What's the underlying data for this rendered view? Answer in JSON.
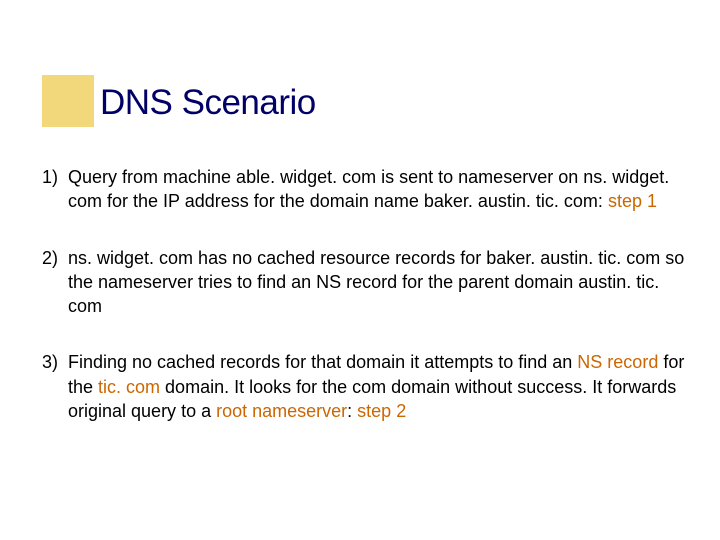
{
  "title": "DNS Scenario",
  "items": [
    {
      "number": "1)",
      "parts": [
        {
          "text": "Query from machine able. widget. com is sent to nameserver on ns. widget. com for the IP address for the domain name baker. austin. tic. com: ",
          "highlight": false
        },
        {
          "text": "step 1",
          "highlight": true
        }
      ]
    },
    {
      "number": "2)",
      "parts": [
        {
          "text": "ns. widget. com has no cached resource records for baker. austin. tic. com so the nameserver tries to find an NS record for the parent domain austin. tic. com",
          "highlight": false
        }
      ]
    },
    {
      "number": "3)",
      "parts": [
        {
          "text": "Finding no cached records for that domain it attempts to find an ",
          "highlight": false
        },
        {
          "text": "NS record",
          "highlight": true
        },
        {
          "text": " for the ",
          "highlight": false
        },
        {
          "text": "tic. com",
          "highlight": true
        },
        {
          "text": " domain. It looks for the com domain without success. It forwards original query to a ",
          "highlight": false
        },
        {
          "text": "root nameserver",
          "highlight": true
        },
        {
          "text": ": ",
          "highlight": false
        },
        {
          "text": "step 2",
          "highlight": true
        }
      ]
    }
  ]
}
